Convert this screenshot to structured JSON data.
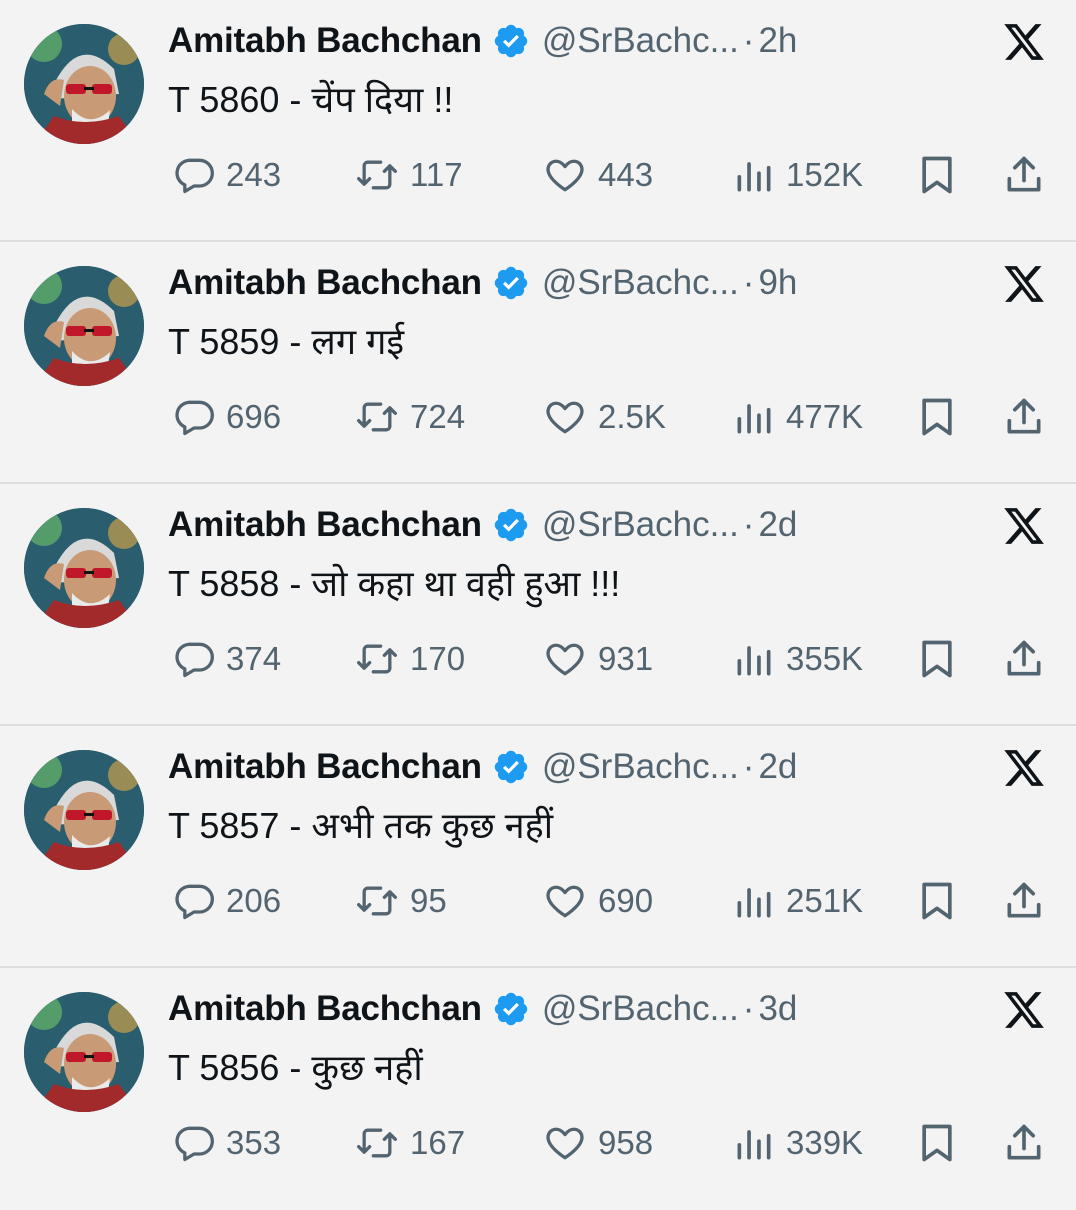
{
  "colors": {
    "background": "#f3f3f3",
    "text_primary": "#0f1419",
    "text_secondary": "#536471",
    "verified_blue": "#1d9bf0",
    "divider": "#dedede"
  },
  "icons": {
    "reply": "reply-icon",
    "retweet": "retweet-icon",
    "like": "heart-icon",
    "views": "views-chart-icon",
    "bookmark": "bookmark-icon",
    "share": "share-icon",
    "platform": "x-logo-icon",
    "verified": "verified-badge-icon"
  },
  "tweets": [
    {
      "name": "Amitabh Bachchan",
      "handle": "@SrBachc...",
      "separator": "·",
      "time": "2h",
      "text": "T 5860 - चेंप  दिया  !!",
      "replies": "243",
      "retweets": "117",
      "likes": "443",
      "views": "152K"
    },
    {
      "name": "Amitabh Bachchan",
      "handle": "@SrBachc...",
      "separator": "·",
      "time": "9h",
      "text": "T 5859 - लग गई",
      "replies": "696",
      "retweets": "724",
      "likes": "2.5K",
      "views": "477K"
    },
    {
      "name": "Amitabh Bachchan",
      "handle": "@SrBachc...",
      "separator": "·",
      "time": "2d",
      "text": "T 5858 - जो कहा था वही हुआ  !!!",
      "replies": "374",
      "retweets": "170",
      "likes": "931",
      "views": "355K"
    },
    {
      "name": "Amitabh Bachchan",
      "handle": "@SrBachc...",
      "separator": "·",
      "time": "2d",
      "text": "T 5857 - अभी तक कुछ नहीं",
      "replies": "206",
      "retweets": "95",
      "likes": "690",
      "views": "251K"
    },
    {
      "name": "Amitabh Bachchan",
      "handle": "@SrBachc...",
      "separator": "·",
      "time": "3d",
      "text": "T 5856 - कुछ नहीं",
      "replies": "353",
      "retweets": "167",
      "likes": "958",
      "views": "339K"
    }
  ]
}
